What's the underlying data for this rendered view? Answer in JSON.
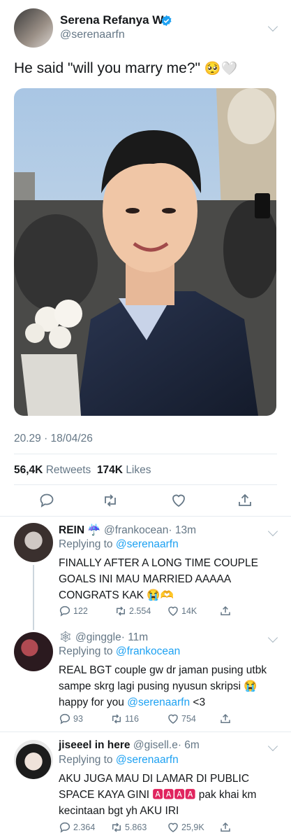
{
  "tweet": {
    "author_name": "Serena Refanya W.",
    "author_handle": "@serenaarfn",
    "text": "He said \"will you marry me?\"",
    "text_emoji": "🥺🤍",
    "timestamp": "20.29 · 18/04/26",
    "retweets_count": "56,4K",
    "retweets_label": "Retweets",
    "likes_count": "174K",
    "likes_label": "Likes"
  },
  "replies": [
    {
      "name": "REIN",
      "name_emoji": "☔",
      "handle": "@frankocean",
      "time": "· 13m",
      "replying_prefix": "Replying to",
      "replying_to": "@serenaarfn",
      "text": "FINALLY AFTER A LONG TIME COUPLE GOALS INI MAU MARRIED AAAAA CONGRATS KAK",
      "text_emoji": "😭🫶",
      "reply_count": "122",
      "retweet_count": "2.554",
      "like_count": "14K"
    },
    {
      "name_emoji": "🕸",
      "handle": "@ginggle",
      "time": "· 11m",
      "replying_prefix": "Replying to",
      "replying_to": "@frankocean",
      "text": "REAL BGT couple gw dr jaman pusing utbk sampe skrg lagi pusing nyusun skripsi",
      "text_emoji": "😭",
      "text_tail_prefix": "happy for you",
      "text_mention": "@serenaarfn",
      "text_tail": "<3",
      "reply_count": "93",
      "retweet_count": "116",
      "like_count": "754"
    },
    {
      "name": "jiseeel in here",
      "handle": "@gisell.e",
      "time": "· 6m",
      "replying_prefix": "Replying to",
      "replying_to": "@serenaarfn",
      "text": "AKU JUGA MAU DI LAMAR DI PUBLIC SPACE KAYA GINI",
      "text_emoji": "🅰🅰🅰🅰",
      "text_tail": "pak khai km kecintaan bgt yh AKU IRI",
      "reply_count": "2.364",
      "retweet_count": "5.863",
      "like_count": "25,9K"
    }
  ],
  "icons": {
    "verified": "verified-badge-icon",
    "chevron": "chevron-down-icon",
    "reply": "reply-icon",
    "retweet": "retweet-icon",
    "like": "heart-icon",
    "share": "share-icon"
  },
  "colors": {
    "accent": "#1da1f2",
    "muted": "#657786",
    "divider": "#e6ecf0"
  }
}
